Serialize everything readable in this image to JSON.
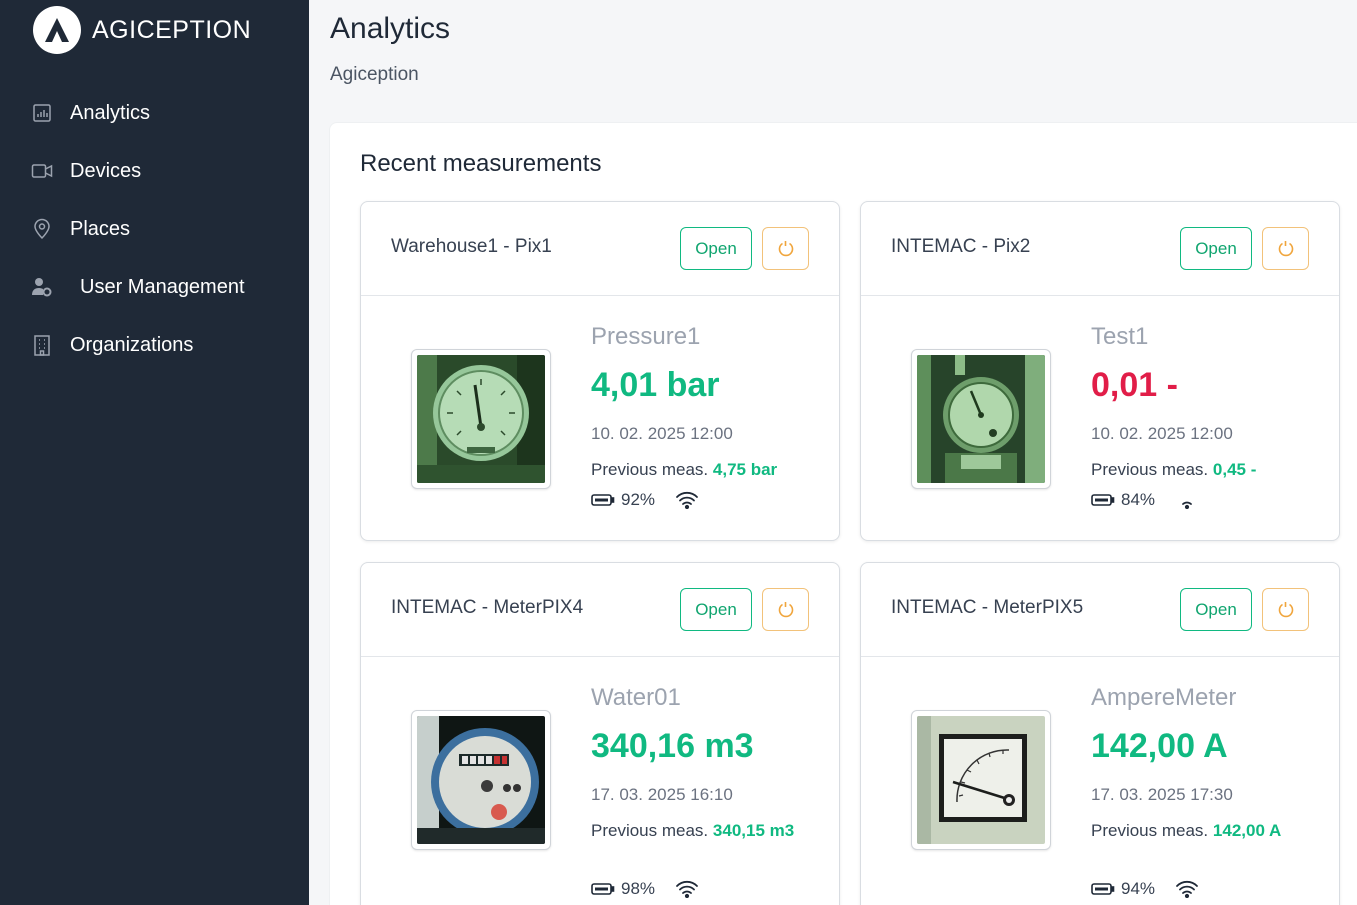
{
  "app": {
    "brand": "AGICEPTION"
  },
  "sidebar": {
    "items": [
      {
        "label": "Analytics",
        "icon": "chart-icon"
      },
      {
        "label": "Devices",
        "icon": "camera-icon"
      },
      {
        "label": "Places",
        "icon": "map-pin-icon"
      },
      {
        "label": "User Management",
        "icon": "user-gear-icon"
      },
      {
        "label": "Organizations",
        "icon": "building-icon"
      }
    ]
  },
  "header": {
    "title": "Analytics",
    "subtitle": "Agiception"
  },
  "section": {
    "title": "Recent measurements"
  },
  "cards": [
    {
      "device": "Warehouse1 - Pix1",
      "open_label": "Open",
      "sensor": "Pressure1",
      "value": "4,01 bar",
      "timestamp": "10. 02. 2025 12:00",
      "prev_label": "Previous meas.",
      "prev_value": "4,75 bar",
      "battery": "92%",
      "image": "pressure-gauge-photo"
    },
    {
      "device": "INTEMAC - Pix2",
      "open_label": "Open",
      "sensor": "Test1",
      "value": "0,01 -",
      "timestamp": "10. 02. 2025 12:00",
      "prev_label": "Previous meas.",
      "prev_value": "0,45 -",
      "battery": "84%",
      "image": "gauge-photo"
    },
    {
      "device": "INTEMAC - MeterPIX4",
      "open_label": "Open",
      "sensor": "Water01",
      "value": "340,16 m3",
      "timestamp": "17. 03. 2025 16:10",
      "prev_label": "Previous meas.",
      "prev_value": "340,15 m3",
      "battery": "98%",
      "image": "water-meter-photo"
    },
    {
      "device": "INTEMAC - MeterPIX5",
      "open_label": "Open",
      "sensor": "AmpereMeter",
      "value": "142,00 A",
      "timestamp": "17. 03. 2025 17:30",
      "prev_label": "Previous meas.",
      "prev_value": "142,00 A",
      "battery": "94%",
      "image": "ampere-meter-photo"
    }
  ],
  "colors": {
    "sidebar": "#1f2937",
    "good": "#10b981",
    "bad": "#e11d48",
    "refresh": "#f2c27a"
  }
}
